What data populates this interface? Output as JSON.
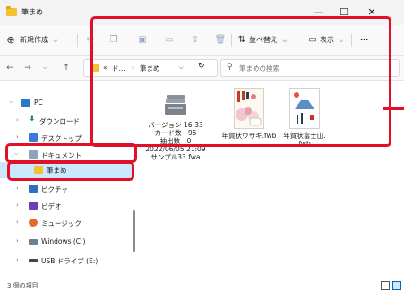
{
  "window": {
    "title": "筆まめ",
    "minimize": "—",
    "maximize": "☐",
    "close": "✕"
  },
  "toolbar": {
    "new_label": "新規作成",
    "new_chevron": "⌵",
    "sort_label": "並べ替え",
    "view_label": "表示",
    "more_label": "···"
  },
  "address": {
    "crumb_prefix": "«",
    "crumb_parent": "ド...",
    "crumb_sep": "›",
    "crumb_current": "筆まめ",
    "search_placeholder": "筆まめの検索"
  },
  "sidebar": {
    "items": [
      {
        "label": "PC"
      },
      {
        "label": "ダウンロード"
      },
      {
        "label": "デスクトップ"
      },
      {
        "label": "ドキュメント"
      },
      {
        "label": "筆まめ"
      },
      {
        "label": "ピクチャ"
      },
      {
        "label": "ビデオ"
      },
      {
        "label": "ミュージック"
      },
      {
        "label": "Windows (C:)"
      },
      {
        "label": "USB ドライブ (E:)"
      }
    ]
  },
  "files": [
    {
      "caption": "バージョン 16-33\nカード数　95\n抽出数　0\n2022/06/05 21:09\nサンプル33.fwa"
    },
    {
      "caption": "年賀状ウサギ.fwb"
    },
    {
      "caption": "年賀状富士山.\nfwb"
    }
  ],
  "status": {
    "text": "3 個の項目"
  },
  "colors": {
    "accent": "#0067c0",
    "selection": "#cce8ff",
    "highlight": "#e0102a",
    "folder": "#f1c232"
  }
}
